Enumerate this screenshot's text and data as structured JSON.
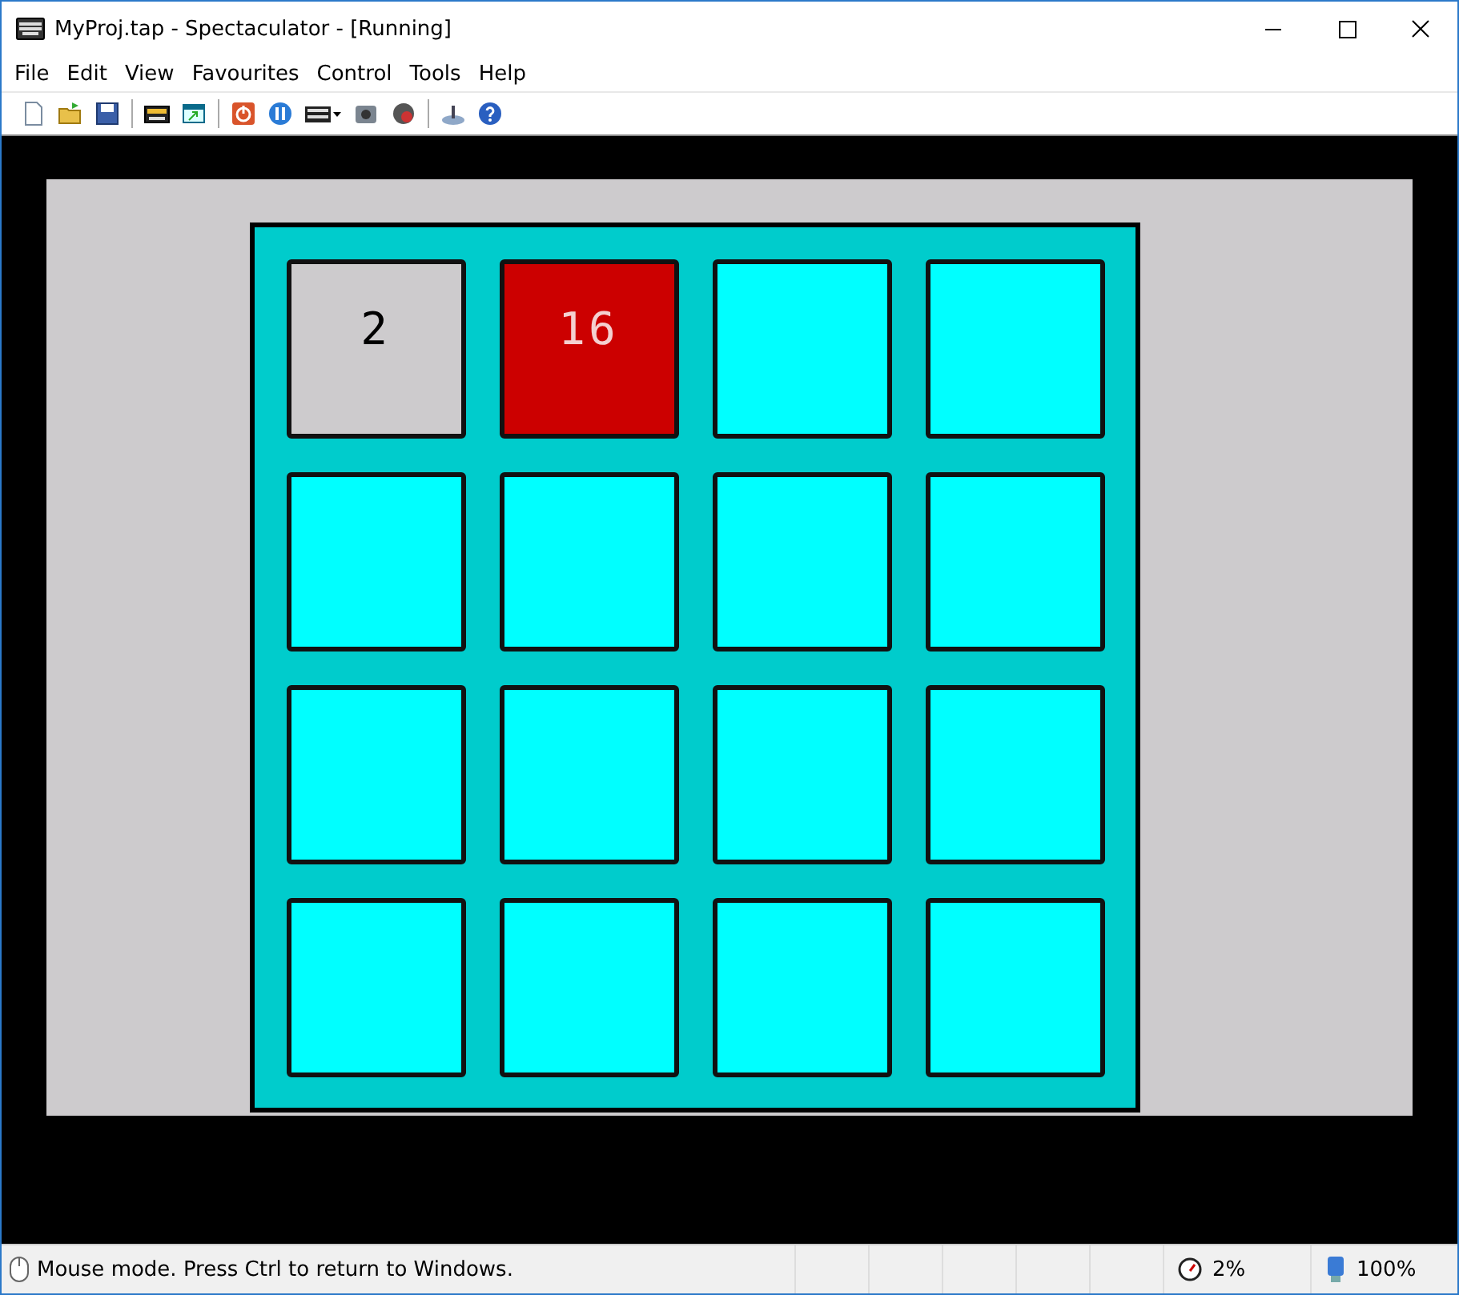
{
  "window": {
    "title": "MyProj.tap - Spectaculator - [Running]"
  },
  "menu": [
    "File",
    "Edit",
    "View",
    "Favourites",
    "Control",
    "Tools",
    "Help"
  ],
  "toolbar": [
    {
      "kind": "new"
    },
    {
      "kind": "open"
    },
    {
      "kind": "save"
    },
    {
      "kind": "sep"
    },
    {
      "kind": "tape"
    },
    {
      "kind": "window"
    },
    {
      "kind": "sep"
    },
    {
      "kind": "power"
    },
    {
      "kind": "pause"
    },
    {
      "kind": "keyboard"
    },
    {
      "kind": "camera"
    },
    {
      "kind": "stop"
    },
    {
      "kind": "sep"
    },
    {
      "kind": "joystick"
    },
    {
      "kind": "help"
    }
  ],
  "board": {
    "tiles": [
      {
        "value": "2",
        "color": "#cdcbcd"
      },
      {
        "value": "16",
        "color": "#cc0000"
      },
      {
        "color": "#00ffff"
      },
      {
        "color": "#00ffff"
      },
      {
        "color": "#00ffff"
      },
      {
        "color": "#00ffff"
      },
      {
        "color": "#00ffff"
      },
      {
        "color": "#00ffff"
      },
      {
        "color": "#00ffff"
      },
      {
        "color": "#00ffff"
      },
      {
        "color": "#00ffff"
      },
      {
        "color": "#00ffff"
      },
      {
        "color": "#00ffff"
      },
      {
        "color": "#00ffff"
      },
      {
        "color": "#00ffff"
      },
      {
        "color": "#00ffff"
      }
    ]
  },
  "status_bar": {
    "message": "Mouse mode. Press Ctrl to return to Windows.",
    "speed": "2%",
    "zoom": "100%"
  }
}
